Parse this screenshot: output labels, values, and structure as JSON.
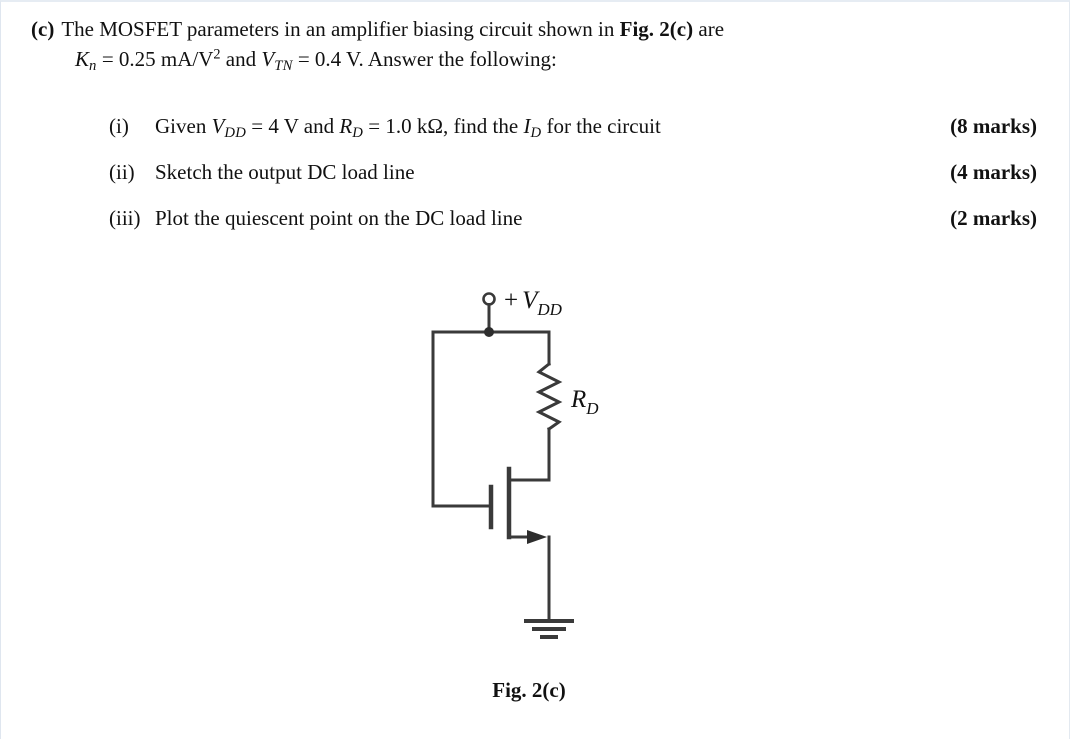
{
  "question": {
    "label": "(c)",
    "line1_parts": {
      "t1": "The MOSFET parameters in an amplifier biasing circuit shown in ",
      "bold": "Fig. 2(c)",
      "t2": " are"
    },
    "line2_parts": {
      "k_var": "K",
      "k_sub": "n",
      "eq1": " = 0.25 mA/V",
      "exp": "2",
      "mid": " and ",
      "v_var": "V",
      "v_sub": "TN",
      "eq2": " = 0.4 V. Answer the following:"
    }
  },
  "items": [
    {
      "num": "(i)",
      "text_parts": {
        "p1": "Given ",
        "v1": "V",
        "v1sub": "DD",
        "p2": " = 4 V and ",
        "v2": "R",
        "v2sub": "D",
        "p3": " = 1.0 kΩ, find the ",
        "v3": "I",
        "v3sub": "D",
        "p4": " for the circuit"
      },
      "marks": "(8 marks)"
    },
    {
      "num": "(ii)",
      "text_parts": {
        "p1": "Sketch the output DC load line",
        "v1": "",
        "v1sub": "",
        "p2": "",
        "v2": "",
        "v2sub": "",
        "p3": "",
        "v3": "",
        "v3sub": "",
        "p4": ""
      },
      "marks": "(4 marks)"
    },
    {
      "num": "(iii)",
      "text_parts": {
        "p1": "Plot the quiescent point on the DC load line",
        "v1": "",
        "v1sub": "",
        "p2": "",
        "v2": "",
        "v2sub": "",
        "p3": "",
        "v3": "",
        "v3sub": "",
        "p4": ""
      },
      "marks": "(2 marks)"
    }
  ],
  "figure": {
    "supply_label_sign": "+",
    "supply_label_var": "V",
    "supply_label_sub": "DD",
    "resistor_label_var": "R",
    "resistor_label_sub": "D",
    "caption": "Fig. 2(c)",
    "line_color": "#3a3a3a",
    "stroke_width": 3
  }
}
